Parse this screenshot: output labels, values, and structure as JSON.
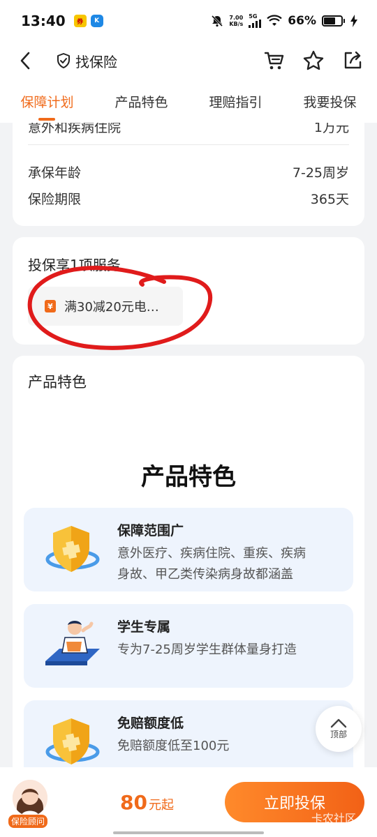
{
  "status_bar": {
    "time": "13:40",
    "speed_value": "7.00",
    "speed_unit": "KB/s",
    "network": "5G",
    "battery": "66%"
  },
  "header": {
    "title": "找保险"
  },
  "tabs": [
    {
      "label": "保障计划",
      "active": true
    },
    {
      "label": "产品特色",
      "active": false
    },
    {
      "label": "理赔指引",
      "active": false
    },
    {
      "label": "我要投保",
      "active": false
    }
  ],
  "info": {
    "cut_label": "意外和疾病住院",
    "cut_value": "1万元",
    "rows": [
      {
        "label": "承保年龄",
        "value": "7-25周岁"
      },
      {
        "label": "保险期限",
        "value": "365天"
      }
    ]
  },
  "service": {
    "title": "投保享1项服务",
    "chip_text": "满30减20元电…"
  },
  "features": {
    "heading": "产品特色",
    "big_title": "产品特色",
    "items": [
      {
        "title": "保障范围广",
        "desc_line1": "意外医疗、疾病住院、重疾、疾病",
        "desc_line2": "身故、甲乙类传染病身故都涵盖"
      },
      {
        "title": "学生专属",
        "desc_line1": "专为7-25周岁学生群体量身打造"
      },
      {
        "title": "免赔额度低",
        "desc_line1": "免赔额度低至100元"
      }
    ]
  },
  "back_top": {
    "label": "顶部"
  },
  "bottom": {
    "advisor_label": "保险顾问",
    "price": "80",
    "price_unit": "元起",
    "buy_label": "立即投保",
    "watermark": "卡农社区"
  },
  "colors": {
    "accent": "#f06a1a",
    "feature_bg": "#eef4fd",
    "annotation": "#e01b1b"
  }
}
